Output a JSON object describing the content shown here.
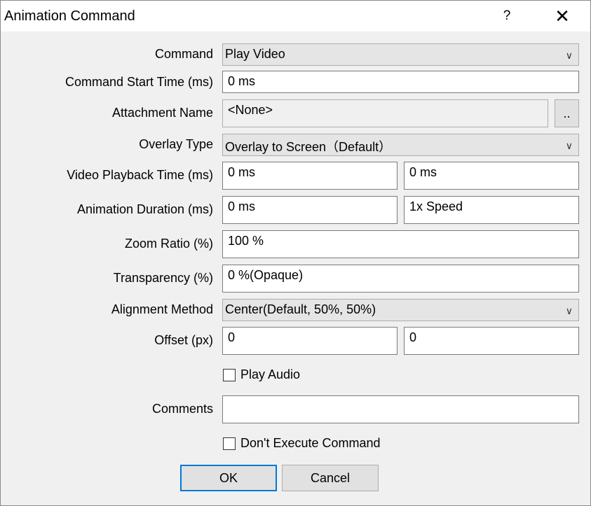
{
  "window": {
    "title": "Animation Command",
    "help_label": "?",
    "close_label": "✕"
  },
  "fields": {
    "command_label": "Command",
    "command_value": "Play Video",
    "start_time_label": "Command Start Time (ms)",
    "start_time_value": "0 ms",
    "attachment_label": "Attachment Name",
    "attachment_value": "<None>",
    "attachment_browse": "..",
    "overlay_label": "Overlay Type",
    "overlay_value": "Overlay to Screen（Default）",
    "playback_label": "Video Playback Time (ms)",
    "playback_start": "0 ms",
    "playback_end": "0 ms",
    "duration_label": "Animation Duration (ms)",
    "duration_value": "0 ms",
    "duration_speed": "1x Speed",
    "zoom_label": "Zoom Ratio (%)",
    "zoom_value": "100 %",
    "transparency_label": "Transparency (%)",
    "transparency_value": "0 %(Opaque)",
    "alignment_label": "Alignment Method",
    "alignment_value": "Center(Default, 50%, 50%)",
    "offset_label": "Offset (px)",
    "offset_x": "0",
    "offset_y": "0",
    "play_audio_label": "Play Audio",
    "play_audio_checked": false,
    "comments_label": "Comments",
    "comments_value": "",
    "dont_execute_label": "Don't Execute Command",
    "dont_execute_checked": false
  },
  "buttons": {
    "ok": "OK",
    "cancel": "Cancel"
  },
  "icons": {
    "dropdown": "chevron-down-icon",
    "close": "close-icon",
    "help": "help-icon"
  }
}
